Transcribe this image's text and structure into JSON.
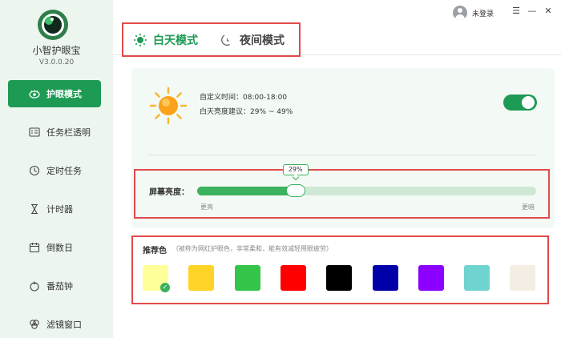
{
  "app": {
    "name": "小智护眼宝",
    "version": "V3.0.0.20"
  },
  "sidebar": {
    "items": [
      {
        "label": "护眼模式",
        "icon": "eye-icon",
        "active": true
      },
      {
        "label": "任务栏透明",
        "icon": "taskbar-icon",
        "active": false
      },
      {
        "label": "定时任务",
        "icon": "clock-icon",
        "active": false
      },
      {
        "label": "计时器",
        "icon": "hourglass-icon",
        "active": false
      },
      {
        "label": "倒数日",
        "icon": "calendar-icon",
        "active": false
      },
      {
        "label": "番茄钟",
        "icon": "tomato-icon",
        "active": false
      },
      {
        "label": "滤镜窗口",
        "icon": "filter-icon",
        "active": false
      }
    ]
  },
  "topbar": {
    "user_label": "未登录",
    "menu_icon": "menu-icon",
    "minimize_icon": "minimize-icon",
    "close_icon": "close-icon"
  },
  "tabs": [
    {
      "label": "白天模式",
      "icon": "sun-icon",
      "active": true
    },
    {
      "label": "夜间模式",
      "icon": "moon-icon",
      "active": false
    }
  ],
  "day_mode": {
    "custom_time": "自定义时间：08:00-18:00",
    "brightness_suggest": "白天亮度建议：29% ~ 49%",
    "enabled": true,
    "brightness_label": "屏幕亮度：",
    "brightness_value": "29%",
    "brightness_fraction": 0.29,
    "low_label": "更亮",
    "high_label": "更暗"
  },
  "recommended": {
    "title": "推荐色",
    "note": "（被称为网红护眼色，非常柔和，能有效减轻用眼疲劳）",
    "colors": [
      "#ffff9a",
      "#ffd426",
      "#35c44a",
      "#ff0000",
      "#000000",
      "#0000a8",
      "#8b00ff",
      "#6fd3cf",
      "#f4ede4"
    ],
    "selected_index": 0
  },
  "colors": {
    "accent": "#1d9a54",
    "highlight_border": "#e24b4b"
  }
}
